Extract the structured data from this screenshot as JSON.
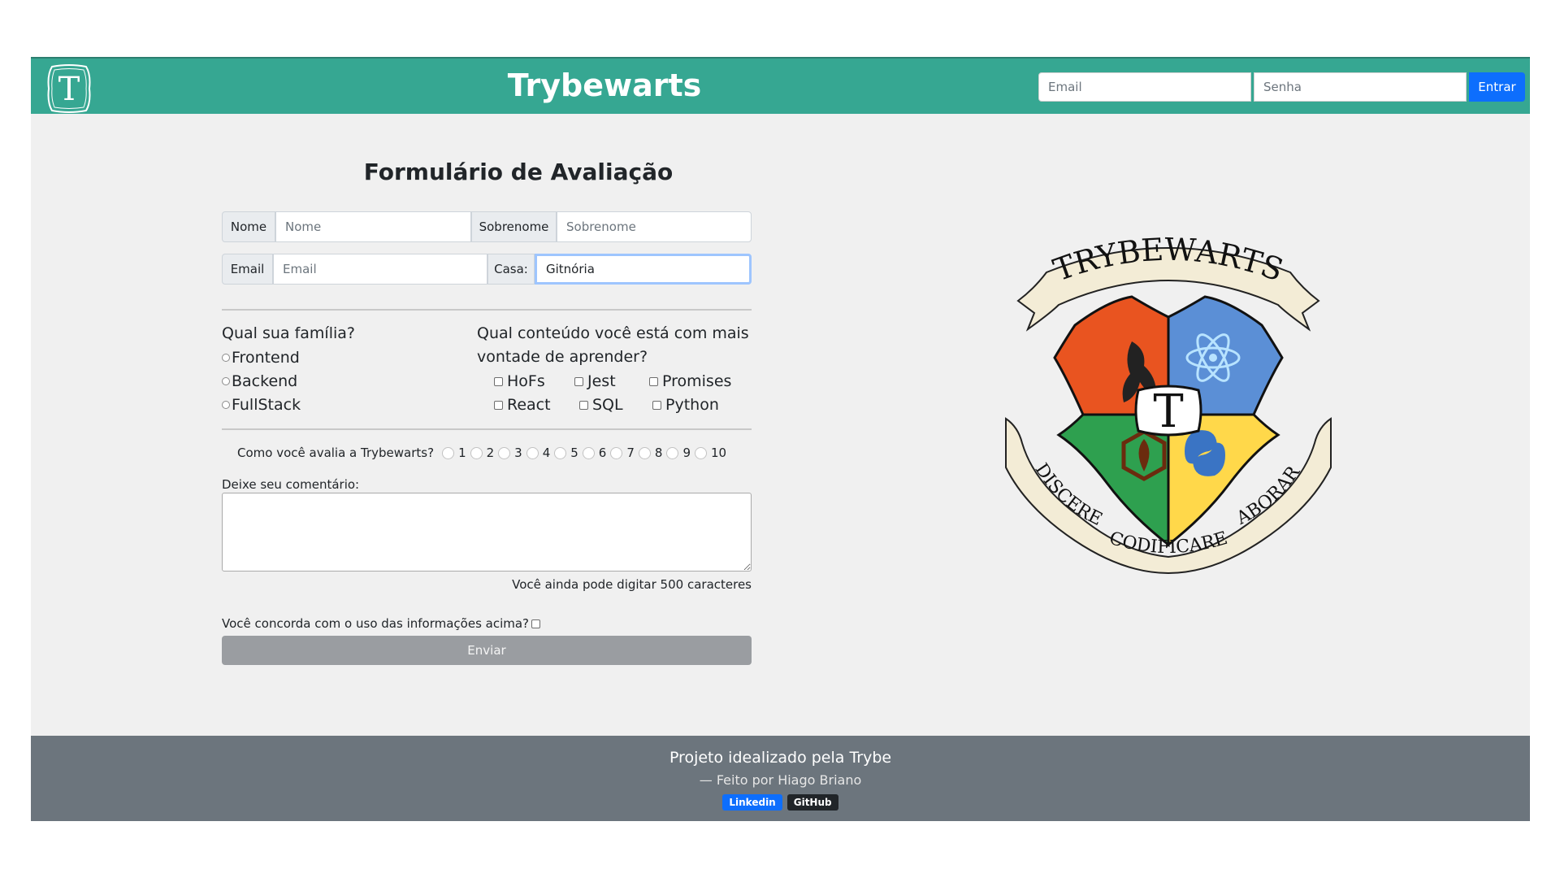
{
  "header": {
    "title": "Trybewarts",
    "logo_letter": "T",
    "email_placeholder": "Email",
    "password_placeholder": "Senha",
    "login_label": "Entrar",
    "color": "#36a792"
  },
  "form": {
    "title": "Formulário de Avaliação",
    "name_label": "Nome",
    "name_placeholder": "Nome",
    "lastname_label": "Sobrenome",
    "lastname_placeholder": "Sobrenome",
    "email_label": "Email",
    "email_placeholder": "Email",
    "house_label": "Casa:",
    "house_value": "Gitnória",
    "family_question": "Qual sua família?",
    "families": [
      "Frontend",
      "Backend",
      "FullStack"
    ],
    "content_question_line1": "Qual conteúdo você está com mais",
    "content_question_line2": "vontade de aprender?",
    "subjects": [
      "HoFs",
      "Jest",
      "Promises",
      "React",
      "SQL",
      "Python"
    ],
    "rating_question": "Como você avalia a Trybewarts?",
    "ratings": [
      "1",
      "2",
      "3",
      "4",
      "5",
      "6",
      "7",
      "8",
      "9",
      "10"
    ],
    "comment_label": "Deixe seu comentário:",
    "char_counter": "Você ainda pode digitar 500 caracteres",
    "agreement": "Você concorda com o uso das informações acima?",
    "submit_label": "Enviar"
  },
  "crest": {
    "banner_top": "TRYBEWARTS",
    "center_letter": "T",
    "motto_left": "DISCERE",
    "motto_bottom": "CODIFICARE",
    "motto_right": "LABORARE"
  },
  "footer": {
    "line1": "Projeto idealizado pela Trybe",
    "line2": "— Feito por Hiago Briano",
    "linkedin": "Linkedin",
    "github": "GitHub"
  }
}
